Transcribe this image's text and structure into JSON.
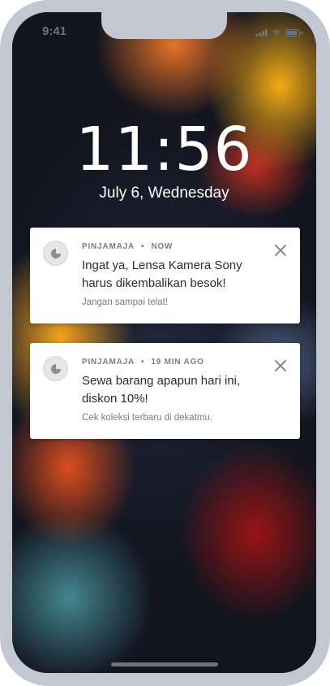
{
  "status_bar": {
    "time": "9:41",
    "battery_level": 0.9,
    "icons": [
      "cellular-signal-icon",
      "wifi-icon",
      "battery-icon"
    ]
  },
  "lock_screen": {
    "time": "11:56",
    "date": "July 6, Wednesday"
  },
  "notifications": [
    {
      "app_name": "PINJAMAJA",
      "separator": "•",
      "timestamp": "NOW",
      "title": "Ingat ya, Lensa Kamera Sony harus dikembalikan besok!",
      "body": "Jangan sampai telat!",
      "icon": "pinjamaja-app-icon",
      "dismiss_icon": "close-icon"
    },
    {
      "app_name": "PINJAMAJA",
      "separator": "•",
      "timestamp": "19 MIN AGO",
      "title": "Sewa barang apapun hari ini, diskon 10%!",
      "body": "Cek koleksi terbaru di dekatmu.",
      "icon": "pinjamaja-app-icon",
      "dismiss_icon": "close-icon"
    }
  ],
  "colors": {
    "frame": "#c2c8d2",
    "card": "#ffffff",
    "title_text": "#2b2d33",
    "muted_text": "#7a7d84"
  }
}
